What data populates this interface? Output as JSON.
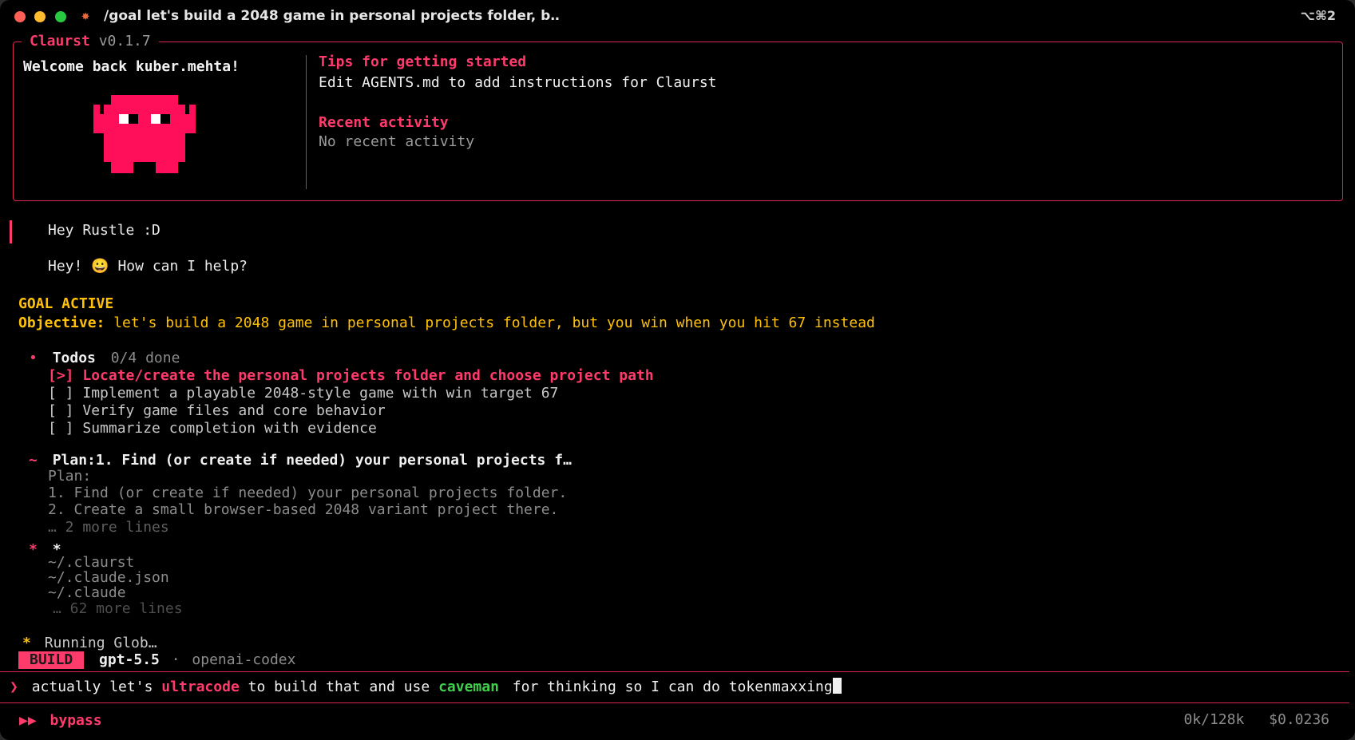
{
  "window": {
    "title": "/goal let's build a 2048 game in personal projects folder, b‥",
    "title_icon": "crab-icon",
    "shortcut": "⌥⌘2"
  },
  "header": {
    "app_name": "Claurst",
    "version": "v0.1.7",
    "welcome": "Welcome back kuber.mehta!",
    "tips_title": "Tips for getting started",
    "tips_text": "Edit AGENTS.md to add instructions for Claurst",
    "recent_title": "Recent activity",
    "recent_text": "No recent activity"
  },
  "conversation": {
    "user_message": "Hey Rustle :D",
    "assistant_reply_pre": "Hey!",
    "assistant_emoji": "😀",
    "assistant_reply_post": "How can I help?"
  },
  "goal": {
    "status": "GOAL ACTIVE",
    "objective_label": "Objective:",
    "objective_text": "let's build a 2048 game in personal projects folder, but you win when you hit 67 instead"
  },
  "todos": {
    "bullet": "•",
    "title": "Todos",
    "progress": "0/4 done",
    "items": [
      {
        "marker": "[>]",
        "text": "Locate/create the personal projects folder and choose project path"
      },
      {
        "marker": "[ ]",
        "text": "Implement a playable 2048-style game with win target 67"
      },
      {
        "marker": "[ ]",
        "text": "Verify game files and core behavior"
      },
      {
        "marker": "[ ]",
        "text": "Summarize completion with evidence"
      }
    ]
  },
  "plan": {
    "marker": "~",
    "heading": "Plan:1. Find (or create if needed) your personal projects f…",
    "lines": [
      "Plan:",
      "1. Find (or create if needed) your personal projects folder.",
      "2. Create a small browser-based 2048 variant project there."
    ],
    "more": "… 2 more lines"
  },
  "glob": {
    "marker": "*",
    "pattern": "*",
    "results": [
      "~/.claurst",
      "~/.claude.json",
      "~/.claude"
    ],
    "more": "… 62 more lines"
  },
  "running": {
    "marker": "*",
    "text": "Running Glob…"
  },
  "model_bar": {
    "mode": "BUILD",
    "model": "gpt-5.5",
    "separator": "·",
    "provider": "openai-codex"
  },
  "input": {
    "prompt": "❯",
    "text_1": "actually let's",
    "keyword_1": "ultracode",
    "text_2": "to build that and use",
    "keyword_2": "caveman",
    "text_3": "for thinking so I can do tokenmaxxing"
  },
  "status_bar": {
    "mode_icon": "▶▶",
    "mode": "bypass",
    "tokens": "0k/128k",
    "cost": "$0.0236"
  },
  "colors": {
    "accent_pink": "#ff3b6b",
    "border_red": "#d9254f",
    "gold": "#ffc107",
    "green": "#3fcf4b",
    "background": "#000000"
  }
}
